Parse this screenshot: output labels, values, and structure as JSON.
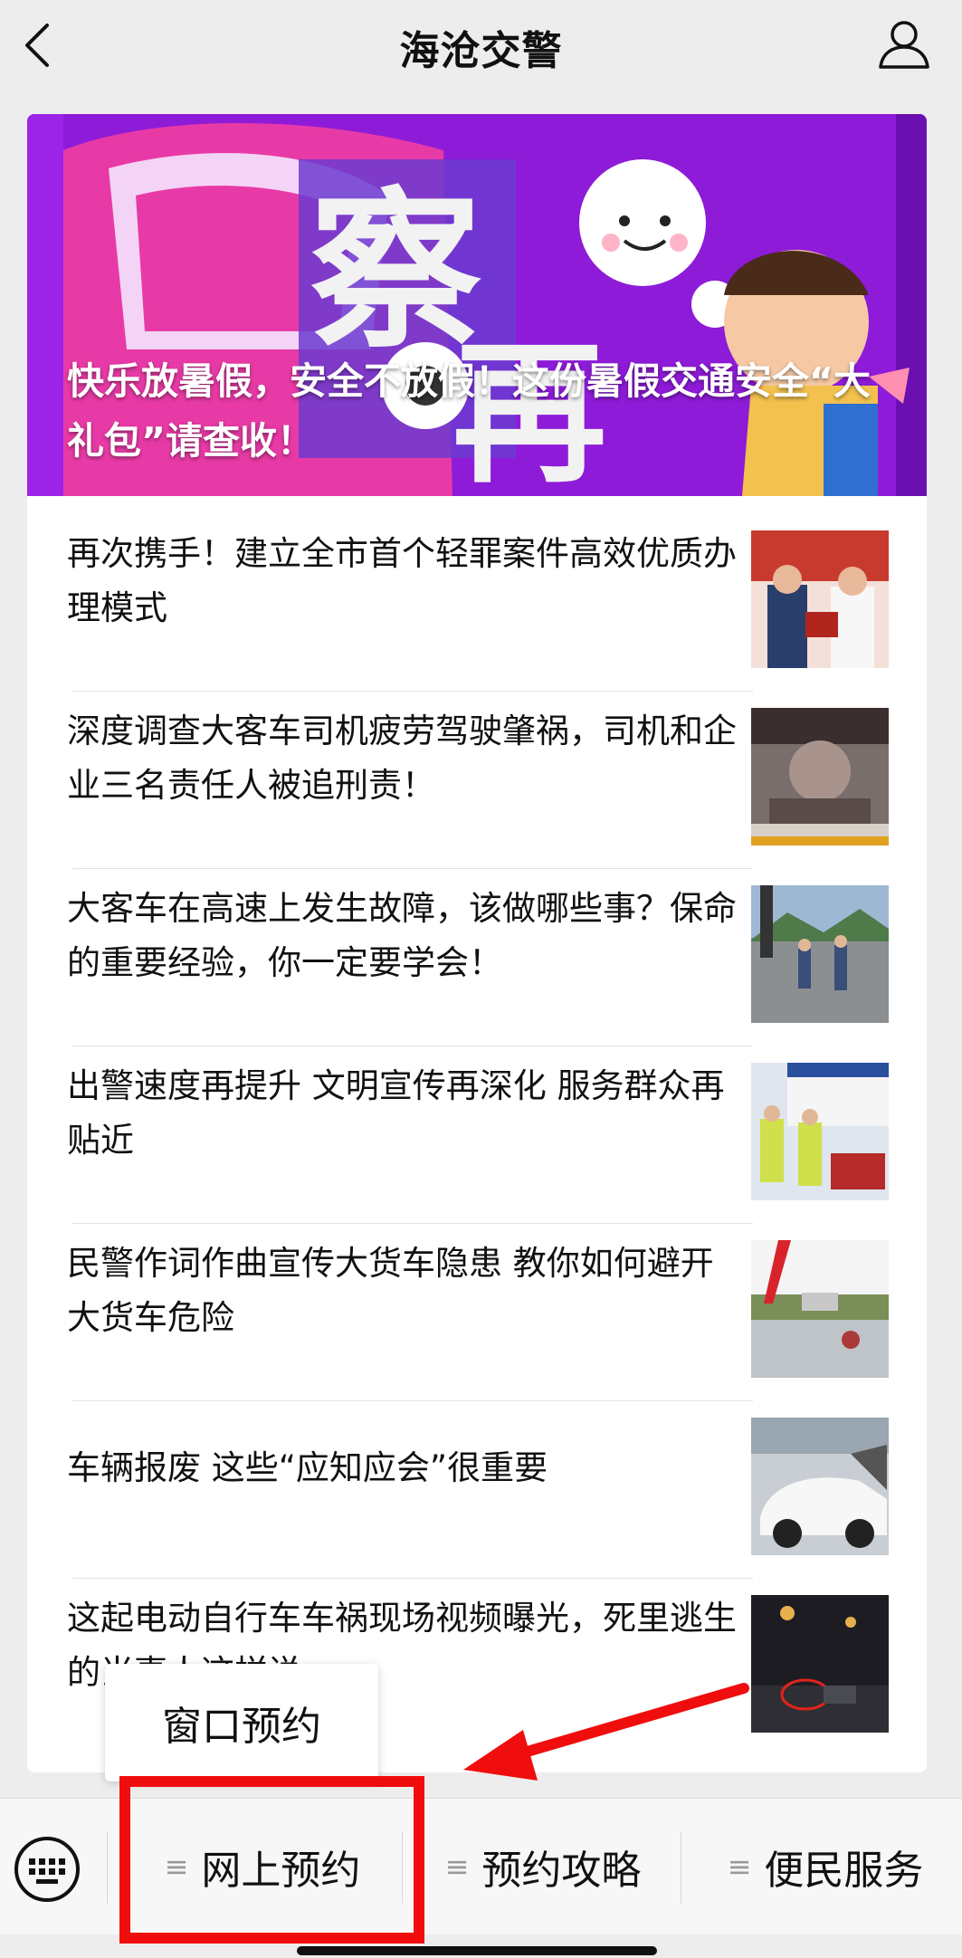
{
  "header": {
    "title": "海沧交警",
    "back_icon": "chevron-left-icon",
    "profile_icon": "user-icon"
  },
  "banner": {
    "title": "快乐放暑假，安全不放假！这份暑假交通安全“大礼包”请查收！"
  },
  "articles": [
    {
      "title": "再次携手！建立全市首个轻罪案件高效优质办理模式"
    },
    {
      "title": "深度调查大客车司机疲劳驾驶肇祸，司机和企业三名责任人被追刑责！"
    },
    {
      "title": "大客车在高速上发生故障，该做哪些事？保命的重要经验，你一定要学会！"
    },
    {
      "title": "出警速度再提升 文明宣传再深化 服务群众再贴近"
    },
    {
      "title": "民警作词作曲宣传大货车隐患 教你如何避开大货车危险"
    },
    {
      "title": "车辆报废 这些“应知应会”很重要"
    },
    {
      "title": "这起电动自行车车祸现场视频曝光，死里逃生的当事人这样说......"
    }
  ],
  "menu": {
    "keyboard_icon": "keyboard-icon",
    "items": [
      {
        "label": "网上预约"
      },
      {
        "label": "预约攻略"
      },
      {
        "label": "便民服务"
      }
    ],
    "hamburger_icon": "≡"
  },
  "popup": {
    "items": [
      {
        "label": "窗口预约"
      }
    ]
  },
  "colors": {
    "background": "#ededed",
    "annotation_red": "#f00d0d",
    "banner_purple": "#8e1bd8",
    "banner_pink": "#e83aa6"
  }
}
